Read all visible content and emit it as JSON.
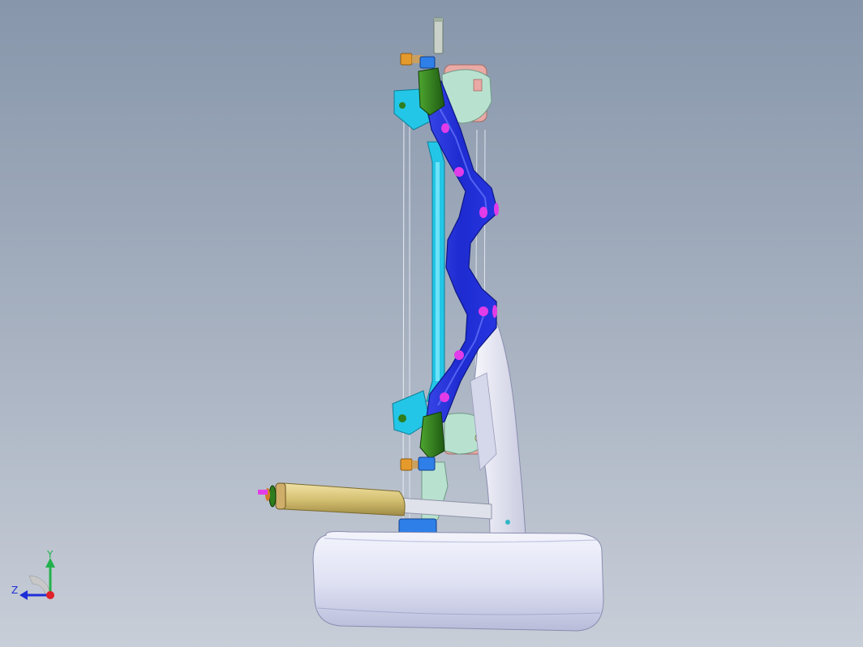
{
  "viewport": {
    "background_top": "#8796ab",
    "background_bottom": "#c8ced8"
  },
  "model": {
    "parts": [
      "upper-mount-bracket",
      "subframe-crossmember",
      "stabilizer-bar",
      "bushing",
      "lower-control-arm",
      "shock-absorber",
      "wheel"
    ],
    "colors": {
      "crossmember": "#1f2fd6",
      "crossmember_light": "#4a5cf0",
      "holes": "#e23ce8",
      "stabilizer": "#23c6e6",
      "bushing": "#2f7d1e",
      "bracket": "#b8e2cf",
      "mount_pink": "#e9a9a4",
      "control_arm": "#e6e6f2",
      "shock_body": "#d8c47a",
      "shock_rod": "#dfe2ea",
      "wheel": "#e2e4f6",
      "bolt": "#e59a2c"
    }
  },
  "triad": {
    "x_label": "",
    "y_label": "Y",
    "z_label": "Z",
    "y_color": "#22b14c",
    "z_color": "#1f2fd6",
    "x_color": "#e0202a"
  }
}
